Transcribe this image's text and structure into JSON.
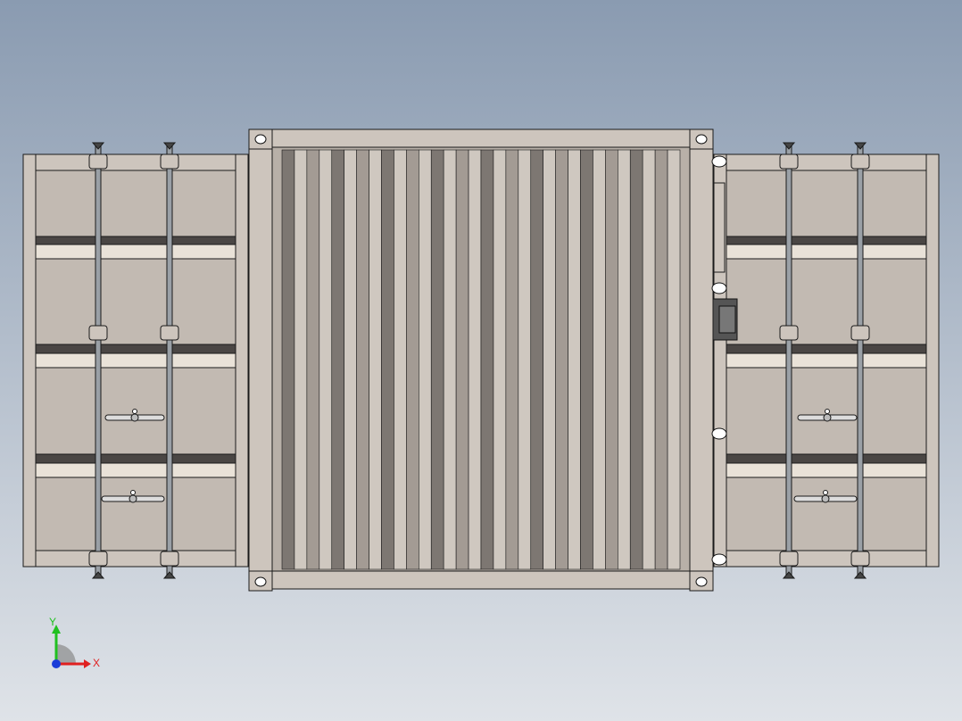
{
  "viewport": {
    "background_top": "#8a9bb1",
    "background_bottom": "#dfe3e8"
  },
  "colors": {
    "container_fill": "#c2bab2",
    "frame_fill": "#cdc5bd",
    "outline": "#1a1a1a",
    "dark_band": "#4a4644",
    "light_band": "#e9e2d8",
    "rod": "#9aa0a6",
    "corrugation_dark": "#7d7772",
    "corrugation_mid": "#a39b94",
    "corrugation_light": "#cfc8c0"
  },
  "corrugation_pattern": [
    "dark",
    "light",
    "mid",
    "light",
    "dark",
    "light",
    "mid",
    "light",
    "dark",
    "light",
    "mid",
    "light",
    "dark",
    "light",
    "mid",
    "light",
    "dark",
    "light",
    "mid",
    "light",
    "dark",
    "light",
    "mid",
    "light",
    "dark",
    "light",
    "mid",
    "light",
    "dark",
    "light",
    "mid",
    "light"
  ],
  "triad": {
    "x_label": "X",
    "y_label": "Y",
    "x_color": "#e02020",
    "y_color": "#20c020",
    "z_color": "#1a3cd8",
    "icon": "coordinate-triad-icon"
  }
}
